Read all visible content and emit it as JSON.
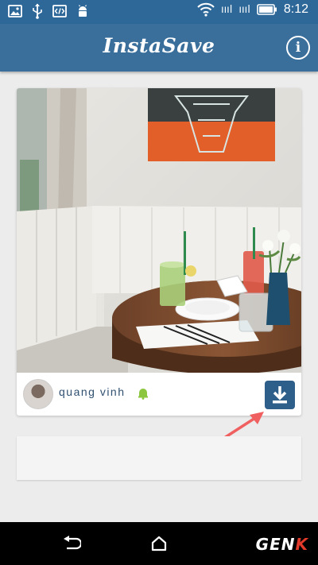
{
  "status_bar": {
    "time": "8:12",
    "signal_1": "ıııl",
    "signal_2": "ıııl"
  },
  "app_bar": {
    "title": "InstaSave",
    "info_label": "i"
  },
  "post": {
    "username": "quang vinh",
    "download_icon": "download-icon"
  },
  "nav": {
    "watermark_main": "GEN",
    "watermark_accent": "K"
  },
  "colors": {
    "app_bar": "#3a6e9b",
    "status_bar": "#2d6899",
    "download_button": "#2e5f8a",
    "arrow": "#f06060"
  }
}
